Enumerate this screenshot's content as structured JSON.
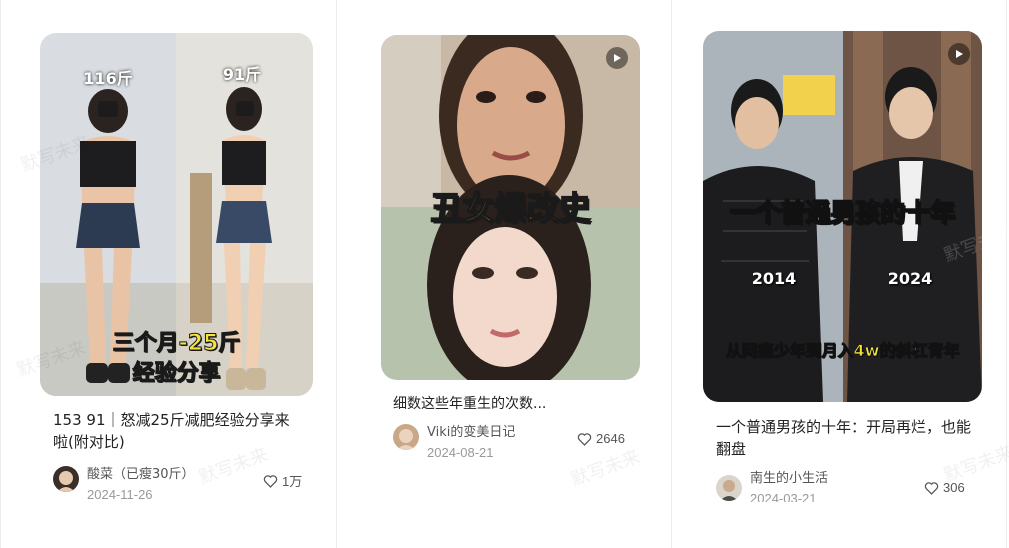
{
  "watermark_text": "默写未来",
  "cards": [
    {
      "image_caption_top_left": "116斤",
      "image_caption_top_right": "91斤",
      "image_caption_line1": "三个月-25斤",
      "image_caption_line2": "经验分享",
      "title": "153 91｜怒减25斤减肥经验分享来啦(附对比)",
      "author": "酸菜（已瘦30斤）",
      "date": "2024-11-26",
      "likes": "1万",
      "has_play_icon": false
    },
    {
      "image_caption_center": "丑女爆改史",
      "title": "细数这些年重生的次数...",
      "author": "Viki的变美日记",
      "date": "2024-08-21",
      "likes": "2646",
      "has_play_icon": true
    },
    {
      "image_caption_title": "一个普通男孩的十年",
      "image_year_left": "2014",
      "image_year_right": "2024",
      "image_caption_bottom": "从网瘾少年到月入4w的斜杠青年",
      "title": "一个普通男孩的十年：开局再烂，也能翻盘",
      "author": "南生的小生活",
      "date": "2024-03-21",
      "likes": "306",
      "has_play_icon": true
    }
  ],
  "colors": {
    "caption_yellow": "#f7e43a",
    "caption_stroke": "#1a1a1a",
    "divider": "#ececec",
    "meta_gray": "#999999"
  },
  "icons": {
    "like": "heart-outline-icon",
    "video": "play-icon"
  }
}
